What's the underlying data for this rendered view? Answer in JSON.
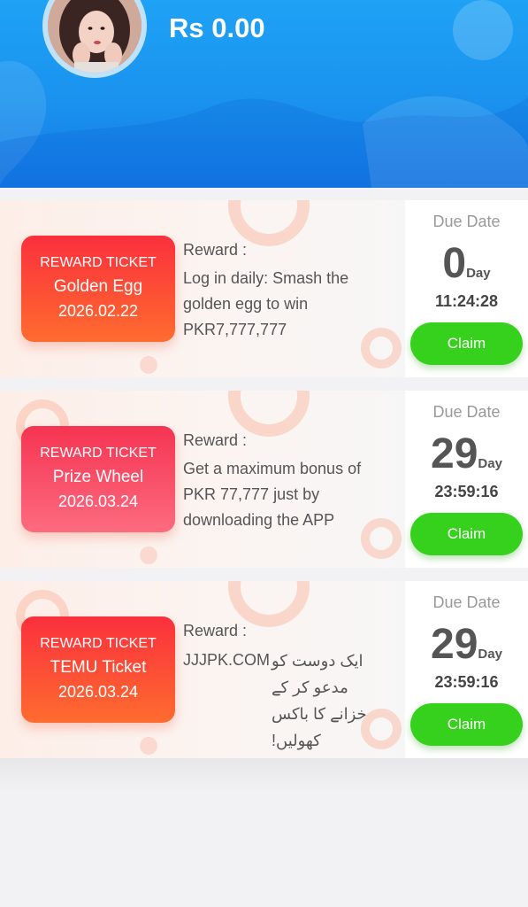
{
  "header": {
    "balance": "Rs 0.00",
    "colors": {
      "accent": "#1a92ee"
    }
  },
  "rewards": [
    {
      "ticket_label": "REWARD TICKET",
      "ticket_name": "Golden Egg",
      "ticket_date": "2026.02.22",
      "reward_label": "Reward :",
      "reward_text": "Log in daily: Smash the golden egg to win PKR7,777,777",
      "due_label": "Due Date",
      "days": "0",
      "days_unit": "Day",
      "timer": "11:24:28",
      "claim_label": "Claim"
    },
    {
      "ticket_label": "REWARD TICKET",
      "ticket_name": "Prize Wheel",
      "ticket_date": "2026.03.24",
      "reward_label": "Reward :",
      "reward_text": "Get a maximum bonus of PKR 77,777 just by downloading the APP",
      "due_label": "Due Date",
      "days": "29",
      "days_unit": "Day",
      "timer": "23:59:16",
      "claim_label": "Claim"
    },
    {
      "ticket_label": "REWARD TICKET",
      "ticket_name": "TEMU Ticket",
      "ticket_date": "2026.03.24",
      "reward_label": "Reward :",
      "reward_site": "JJJPK.COM",
      "reward_text": "ایک دوست کو مدعو کر کے خزانے کا باکس کھولیں!",
      "due_label": "Due Date",
      "days": "29",
      "days_unit": "Day",
      "timer": "23:59:16",
      "claim_label": "Claim"
    }
  ],
  "colors": {
    "claim_button": "#36d11c",
    "ticket_orange": "#fe6c2f",
    "ticket_pink": "#f53452"
  }
}
